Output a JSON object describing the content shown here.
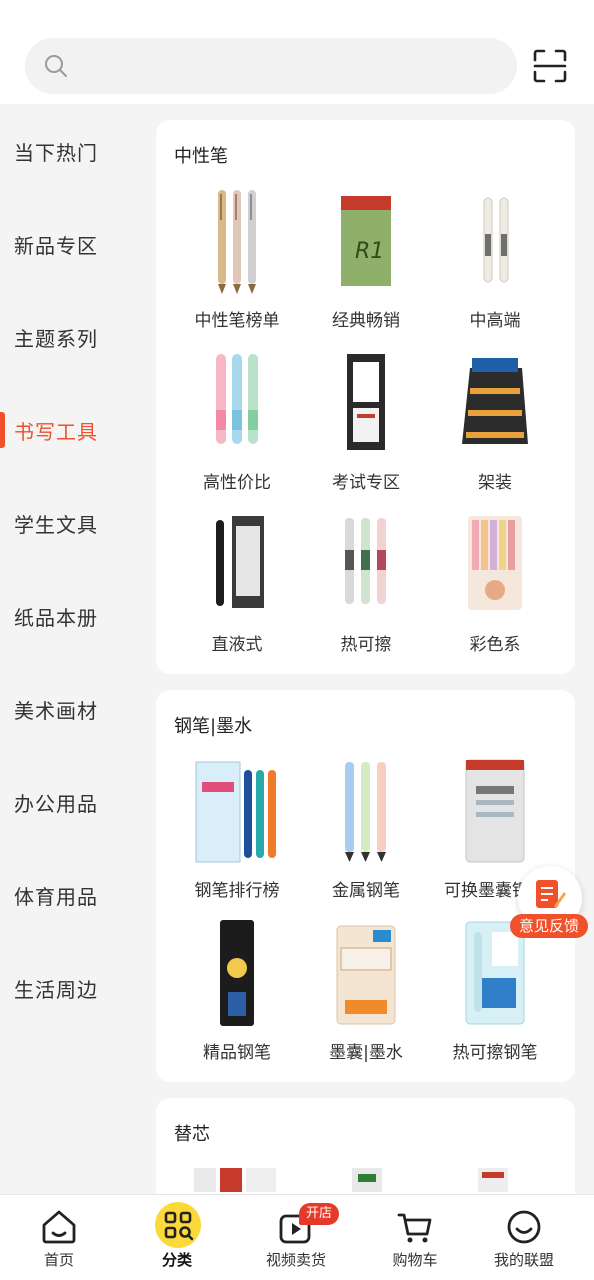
{
  "search": {
    "placeholder": ""
  },
  "sidebar": {
    "items": [
      {
        "label": "当下热门"
      },
      {
        "label": "新品专区"
      },
      {
        "label": "主题系列"
      },
      {
        "label": "书写工具"
      },
      {
        "label": "学生文具"
      },
      {
        "label": "纸品本册"
      },
      {
        "label": "美术画材"
      },
      {
        "label": "办公用品"
      },
      {
        "label": "体育用品"
      },
      {
        "label": "生活周边"
      }
    ],
    "active_index": 3
  },
  "sections": [
    {
      "title": "中性笔",
      "items": [
        {
          "label": "中性笔榜单",
          "icon": "gold-pens-icon"
        },
        {
          "label": "经典畅销",
          "icon": "refill-pack-icon"
        },
        {
          "label": "中高端",
          "icon": "white-pens-icon"
        },
        {
          "label": "高性价比",
          "icon": "pastel-pens-icon"
        },
        {
          "label": "考试专区",
          "icon": "exam-pen-box-icon"
        },
        {
          "label": "架装",
          "icon": "pen-rack-icon"
        },
        {
          "label": "直液式",
          "icon": "liquid-pen-icon"
        },
        {
          "label": "热可擦",
          "icon": "erasable-pens-icon"
        },
        {
          "label": "彩色系",
          "icon": "color-pens-icon"
        }
      ]
    },
    {
      "title": "钢笔|墨水",
      "items": [
        {
          "label": "钢笔排行榜",
          "icon": "fountain-pen-set-icon"
        },
        {
          "label": "金属钢笔",
          "icon": "metal-pens-icon"
        },
        {
          "label": "可换墨囊钢笔",
          "icon": "cartridge-pen-icon"
        },
        {
          "label": "精品钢笔",
          "icon": "premium-pen-icon"
        },
        {
          "label": "墨囊|墨水",
          "icon": "ink-cartridge-icon"
        },
        {
          "label": "热可擦钢笔",
          "icon": "erasable-fountain-icon"
        }
      ]
    },
    {
      "title": "替芯",
      "items": []
    }
  ],
  "feedback": {
    "label": "意见反馈"
  },
  "bottom_nav": [
    {
      "label": "首页",
      "icon": "home-icon"
    },
    {
      "label": "分类",
      "icon": "category-icon"
    },
    {
      "label": "视频卖货",
      "icon": "video-icon",
      "badge": "开店"
    },
    {
      "label": "购物车",
      "icon": "cart-icon"
    },
    {
      "label": "我的联盟",
      "icon": "smile-icon"
    }
  ],
  "colors": {
    "accent": "#f0502a",
    "category_active_bg": "#fbd93a"
  }
}
